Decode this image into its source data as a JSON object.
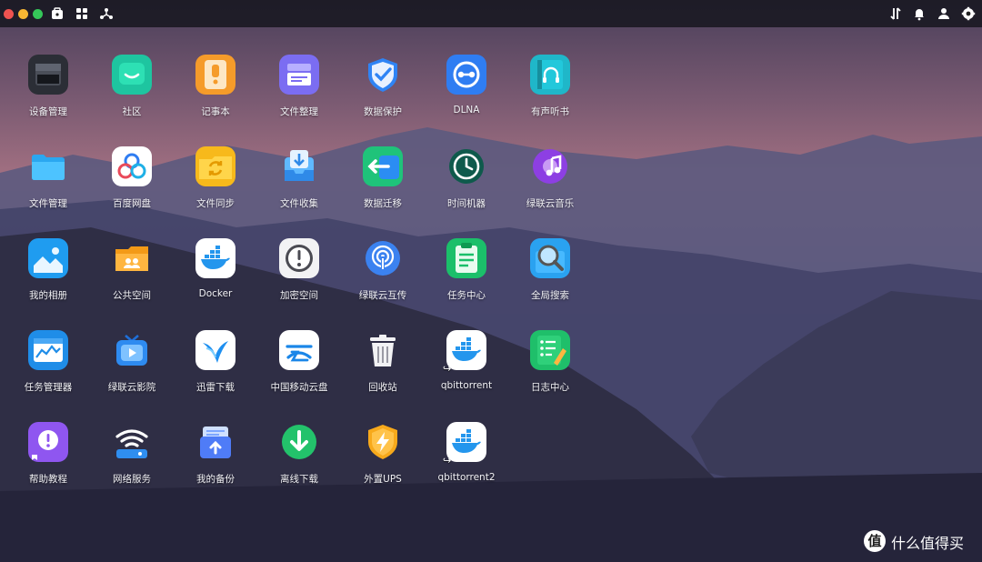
{
  "topbar": {
    "window_controls": [
      "close",
      "minimize",
      "maximize"
    ],
    "left_icons": [
      "app-center-icon",
      "grid-icon",
      "share-network-icon"
    ],
    "right_icons": [
      "transfer-icon",
      "bell-icon",
      "user-icon",
      "settings-gear-icon"
    ]
  },
  "apps": [
    {
      "label": "设备管理",
      "icon": "device-management-icon"
    },
    {
      "label": "社区",
      "icon": "community-icon"
    },
    {
      "label": "记事本",
      "icon": "notepad-icon"
    },
    {
      "label": "文件整理",
      "icon": "file-organize-icon"
    },
    {
      "label": "数据保护",
      "icon": "data-protection-icon"
    },
    {
      "label": "DLNA",
      "icon": "dlna-icon"
    },
    {
      "label": "有声听书",
      "icon": "audiobook-icon"
    },
    {
      "label": "文件管理",
      "icon": "file-manager-icon"
    },
    {
      "label": "百度网盘",
      "icon": "baidu-netdisk-icon"
    },
    {
      "label": "文件同步",
      "icon": "file-sync-icon"
    },
    {
      "label": "文件收集",
      "icon": "file-collect-icon"
    },
    {
      "label": "数据迁移",
      "icon": "data-migration-icon"
    },
    {
      "label": "时间机器",
      "icon": "time-machine-icon"
    },
    {
      "label": "绿联云音乐",
      "icon": "music-icon"
    },
    {
      "label": "我的相册",
      "icon": "photo-album-icon"
    },
    {
      "label": "公共空间",
      "icon": "public-space-icon"
    },
    {
      "label": "Docker",
      "icon": "docker-icon"
    },
    {
      "label": "加密空间",
      "icon": "encrypted-space-icon"
    },
    {
      "label": "绿联云互传",
      "icon": "airdrop-transfer-icon"
    },
    {
      "label": "任务中心",
      "icon": "task-center-icon"
    },
    {
      "label": "全局搜索",
      "icon": "global-search-icon"
    },
    {
      "label": "任务管理器",
      "icon": "task-manager-icon"
    },
    {
      "label": "绿联云影院",
      "icon": "cinema-icon"
    },
    {
      "label": "迅雷下载",
      "icon": "xunlei-download-icon"
    },
    {
      "label": "中国移动云盘",
      "icon": "china-mobile-cloud-icon"
    },
    {
      "label": "回收站",
      "icon": "recycle-bin-icon"
    },
    {
      "label": "qbittorrent",
      "icon": "docker-shortcut-icon",
      "shortcut": true
    },
    {
      "label": "日志中心",
      "icon": "log-center-icon"
    },
    {
      "label": "帮助教程",
      "icon": "help-icon"
    },
    {
      "label": "网络服务",
      "icon": "network-service-icon"
    },
    {
      "label": "我的备份",
      "icon": "backup-icon"
    },
    {
      "label": "离线下载",
      "icon": "offline-download-icon"
    },
    {
      "label": "外置UPS",
      "icon": "ups-icon"
    },
    {
      "label": "qbittorrent2",
      "icon": "docker-shortcut-icon",
      "shortcut": true
    }
  ],
  "watermark": {
    "badge": "值",
    "text": "什么值得买"
  }
}
